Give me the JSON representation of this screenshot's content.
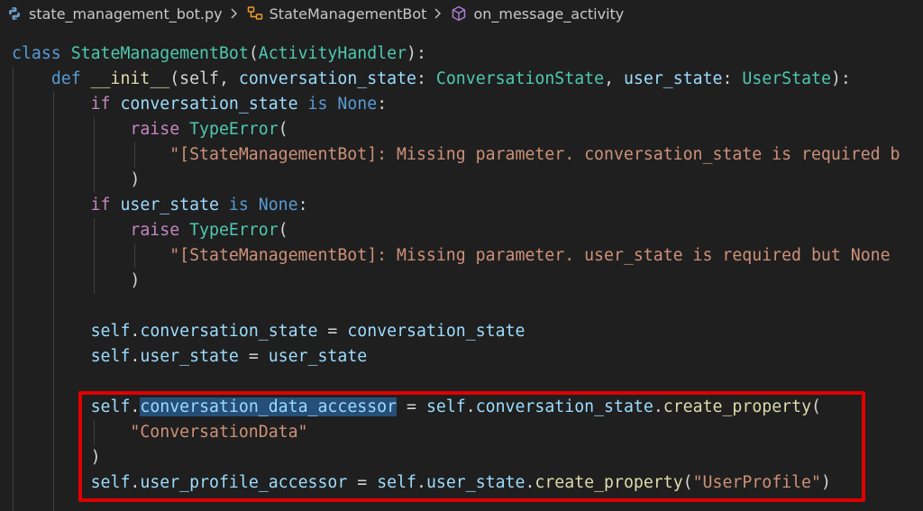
{
  "breadcrumb": {
    "file": "state_management_bot.py",
    "class": "StateManagementBot",
    "method": "on_message_activity"
  },
  "colors": {
    "background": "#1f1f1f",
    "keyword_blue": "#569cd6",
    "keyword_purple": "#c586c0",
    "class_teal": "#4ec9b0",
    "function_yellow": "#dcdcaa",
    "variable": "#9cdcfe",
    "string": "#ce9178",
    "highlight_box": "#e00000",
    "selection": "#264f78"
  },
  "code": {
    "l1": {
      "kw": "class",
      "name": "StateManagementBot",
      "p1": "(",
      "base": "ActivityHandler",
      "p2": "):"
    },
    "l2": {
      "kw": "def",
      "name": "__init__",
      "p1": "(self, ",
      "a1": "conversation_state",
      "c1": ": ",
      "t1": "ConversationState",
      "c2": ", ",
      "a2": "user_state",
      "c3": ": ",
      "t2": "UserState",
      "p2": "):"
    },
    "l3": {
      "kw": "if",
      "v": "conversation_state",
      "is": "is",
      "none": "None",
      "colon": ":"
    },
    "l4": {
      "kw": "raise",
      "err": "TypeError",
      "p": "("
    },
    "l5": {
      "str": "\"[StateManagementBot]: Missing parameter. conversation_state is required b"
    },
    "l6": {
      "p": ")"
    },
    "l7": {
      "kw": "if",
      "v": "user_state",
      "is": "is",
      "none": "None",
      "colon": ":"
    },
    "l8": {
      "kw": "raise",
      "err": "TypeError",
      "p": "("
    },
    "l9": {
      "str": "\"[StateManagementBot]: Missing parameter. user_state is required but None"
    },
    "l10": {
      "p": ")"
    },
    "l11": {
      "self": "self",
      "dot": ".",
      "attr": "conversation_state",
      "eq": " = ",
      "val": "conversation_state"
    },
    "l12": {
      "self": "self",
      "dot": ".",
      "attr": "user_state",
      "eq": " = ",
      "val": "user_state"
    },
    "l13": {
      "self": "self",
      "dot": ".",
      "attr": "conversation_data_accessor",
      "eq": " = ",
      "self2": "self",
      "dot2": ".",
      "attr2": "conversation_state",
      "dot3": ".",
      "fn": "create_property",
      "p": "("
    },
    "l14": {
      "str": "\"ConversationData\""
    },
    "l15": {
      "p": ")"
    },
    "l16": {
      "self": "self",
      "dot": ".",
      "attr": "user_profile_accessor",
      "eq": " = ",
      "self2": "self",
      "dot2": ".",
      "attr2": "user_state",
      "dot3": ".",
      "fn": "create_property",
      "p1": "(",
      "str": "\"UserProfile\"",
      "p2": ")"
    }
  }
}
